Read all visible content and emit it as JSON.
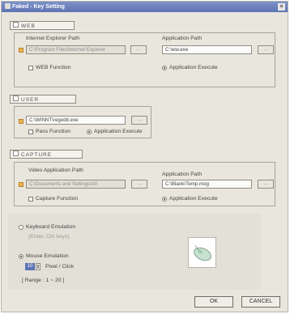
{
  "window": {
    "title": "Faked - Key Setting",
    "close_glyph": "×"
  },
  "web": {
    "tab_label": "WEB",
    "ie_path_label": "Internet Explorer Path",
    "ie_path_value": "C:\\Program Files\\Internet Explorer",
    "browse_label": "...",
    "app_path_label": "Application Path",
    "app_path_value": "C:\\ww.exe",
    "web_function_label": "WEB Function",
    "app_execute_label": "Application Execute"
  },
  "user": {
    "tab_label": "USER",
    "path_value": "C:\\WINNT\\regedit.exe",
    "browse_label": "...",
    "pass_function_label": "Pass Function",
    "app_execute_label": "Application Execute"
  },
  "capture": {
    "tab_label": "CAPTURE",
    "video_path_label": "Video Application Path",
    "video_path_value": "C:\\Documents and Settings\\All",
    "browse1_label": "...",
    "app_path_label": "Application Path",
    "app_path_value": "C:\\Blank\\Temp.mog",
    "browse2_label": "...",
    "capture_function_label": "Capture Function",
    "app_execute_label": "Application Execute"
  },
  "emulation": {
    "keyboard_label": "Keyboard Emulation",
    "keyboard_sub_label": "(Enter, Ctrl keys)",
    "mouse_label": "Mouse Emulation",
    "pixel_value": "10",
    "pixel_label": "Pixel / Click",
    "range_label": "[ Range : 1 ~ 20 ]"
  },
  "buttons": {
    "ok": "OK",
    "cancel": "CANCEL"
  },
  "colors": {
    "title_bar": "#5e73b3",
    "accent_checkbox": "#f0b550",
    "panel": "#e9e6dd"
  }
}
